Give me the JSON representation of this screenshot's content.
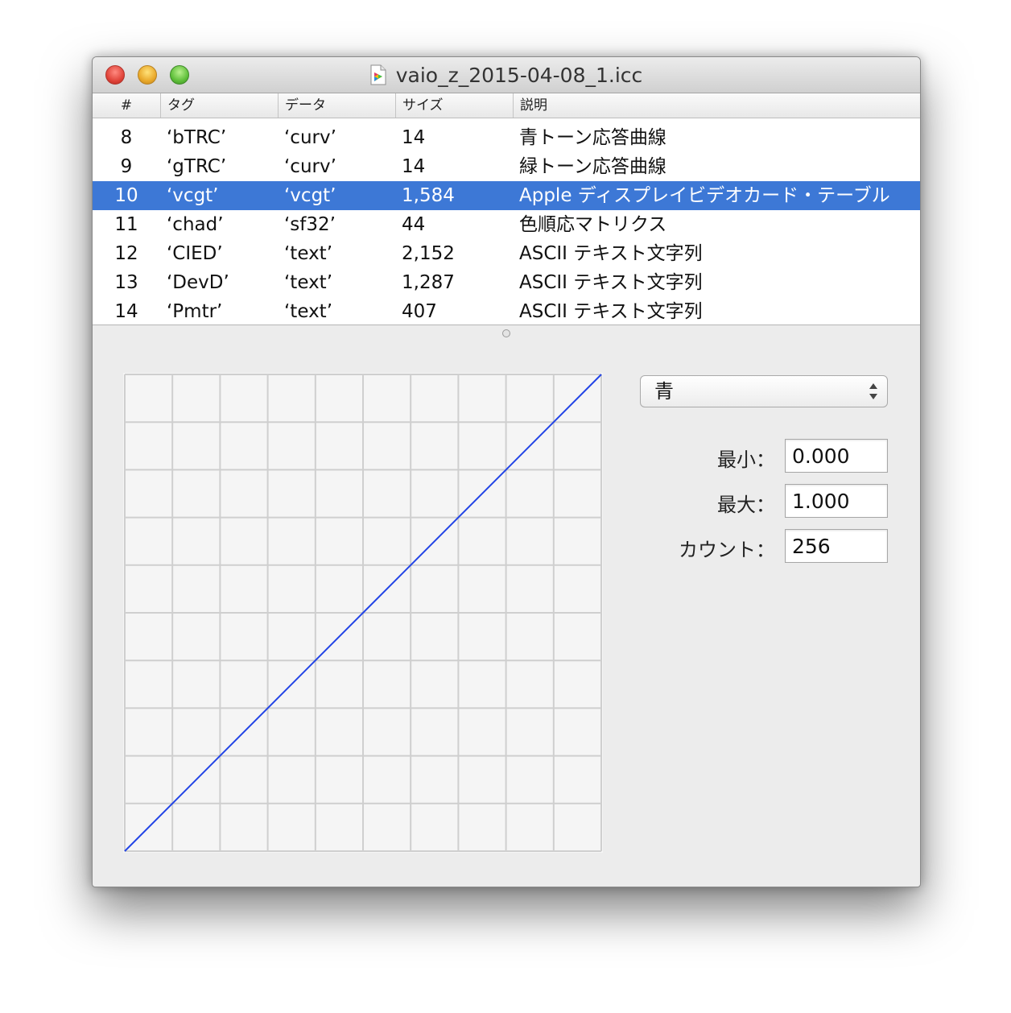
{
  "window": {
    "title": "vaio_z_2015-04-08_1.icc"
  },
  "table": {
    "columns": [
      "#",
      "タグ",
      "データ",
      "サイズ",
      "説明"
    ],
    "rows": [
      {
        "num": "8",
        "tag": "‘bTRC’",
        "data": "‘curv’",
        "size": "14",
        "desc": "青トーン応答曲線",
        "selected": false
      },
      {
        "num": "9",
        "tag": "‘gTRC’",
        "data": "‘curv’",
        "size": "14",
        "desc": "緑トーン応答曲線",
        "selected": false
      },
      {
        "num": "10",
        "tag": "‘vcgt’",
        "data": "‘vcgt’",
        "size": "1,584",
        "desc": "Apple ディスプレイビデオカード・テーブル",
        "selected": true
      },
      {
        "num": "11",
        "tag": "‘chad’",
        "data": "‘sf32’",
        "size": "44",
        "desc": "色順応マトリクス",
        "selected": false
      },
      {
        "num": "12",
        "tag": "‘CIED’",
        "data": "‘text’",
        "size": "2,152",
        "desc": "ASCII テキスト文字列",
        "selected": false
      },
      {
        "num": "13",
        "tag": "‘DevD’",
        "data": "‘text’",
        "size": "1,287",
        "desc": "ASCII テキスト文字列",
        "selected": false
      },
      {
        "num": "14",
        "tag": "‘Pmtr’",
        "data": "‘text’",
        "size": "407",
        "desc": "ASCII テキスト文字列",
        "selected": false
      }
    ]
  },
  "controls": {
    "channel_popup": "青",
    "min_label": "最小：",
    "min_value": "0.000",
    "max_label": "最大：",
    "max_value": "1.000",
    "count_label": "カウント：",
    "count_value": "256"
  },
  "chart_data": {
    "type": "line",
    "xlim": [
      0,
      1
    ],
    "ylim": [
      0,
      1
    ],
    "grid": true,
    "grid_divisions": 10,
    "series": [
      {
        "color": "#2244e6",
        "x": [
          0,
          0.1,
          0.2,
          0.3,
          0.4,
          0.5,
          0.6,
          0.7,
          0.8,
          0.9,
          1.0
        ],
        "y": [
          0,
          0.1,
          0.2,
          0.3,
          0.4,
          0.5,
          0.6,
          0.7,
          0.8,
          0.9,
          1.0
        ]
      }
    ]
  },
  "colors": {
    "selection": "#3d78d6",
    "curve": "#2244e6"
  }
}
